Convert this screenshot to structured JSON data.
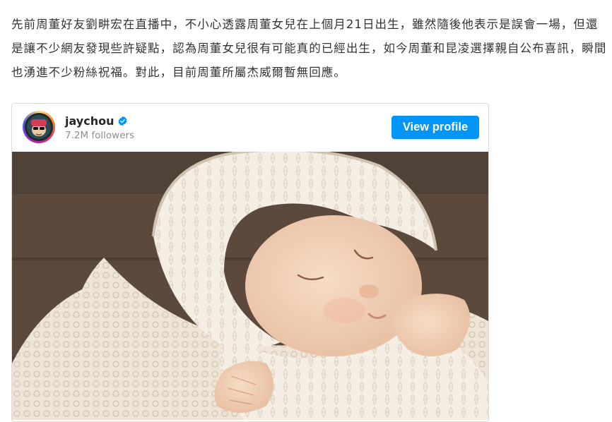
{
  "article": {
    "paragraph": "先前周董好友劉畊宏在直播中，不小心透露周董女兒在上個月21日出生，雖然隨後他表示是誤會一場，但還是讓不少網友發現些許疑點，認為周董女兒很有可能真的已經出生，如今周董和昆凌選擇親自公布喜訊，瞬間也湧進不少粉絲祝福。對此，目前周董所屬杰威爾暫無回應。"
  },
  "embed": {
    "username": "jaychou",
    "followers": "7.2M followers",
    "view_profile_label": "View profile",
    "verified_icon": "verified-badge-icon",
    "button_color": "#0095f6",
    "photo_subject": "newborn-baby-photo"
  }
}
